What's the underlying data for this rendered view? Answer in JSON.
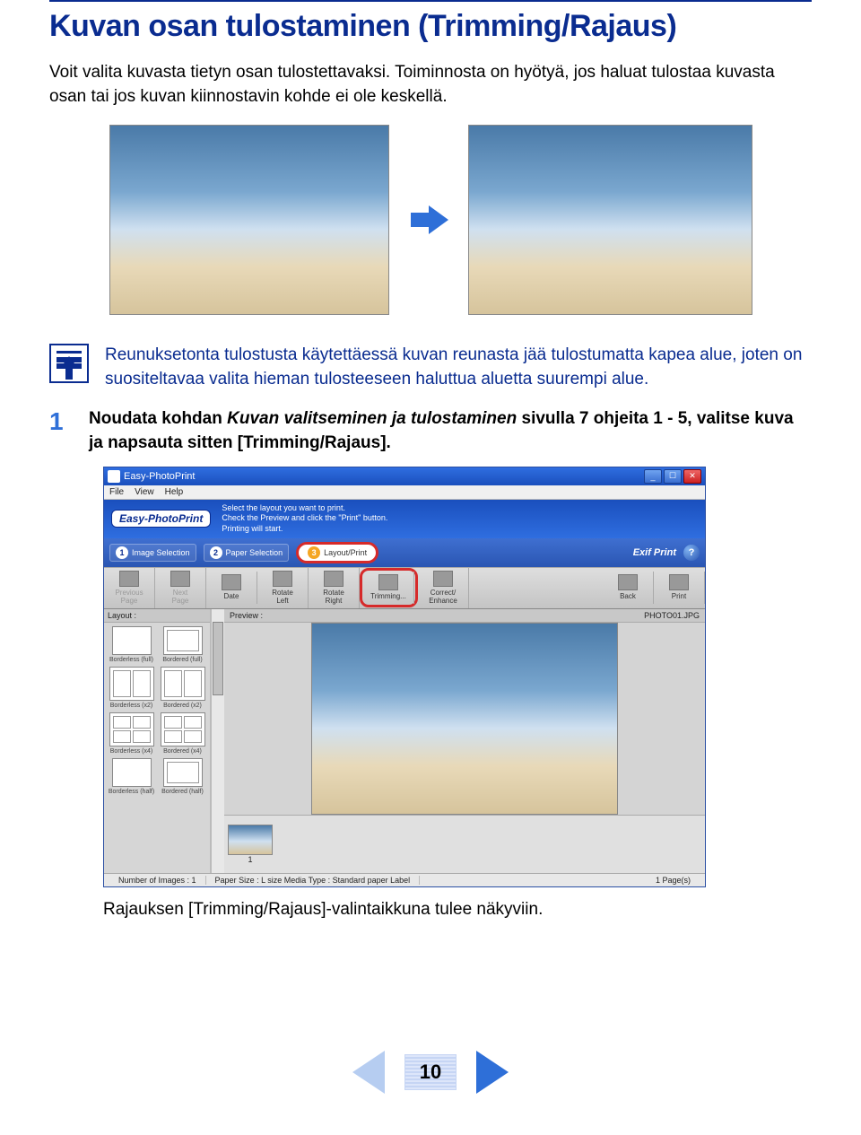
{
  "heading": "Kuvan osan tulostaminen (Trimming/Rajaus)",
  "intro": "Voit valita kuvasta tietyn osan tulostettavaksi. Toiminnosta on hyötyä, jos haluat tulostaa kuvasta osan tai jos kuvan kiinnostavin kohde ei ole keskellä.",
  "note": "Reunuksetonta tulostusta käytettäessä kuvan reunasta jää tulostumatta kapea alue, joten on suositeltavaa valita hieman tulosteeseen haluttua aluetta suurempi alue.",
  "step": {
    "num": "1",
    "prefix": "Noudata kohdan ",
    "em": "Kuvan valitseminen ja tulostaminen",
    "suffix": " sivulla 7 ohjeita 1 - 5, valitse kuva ja napsauta sitten [Trimming/Rajaus]."
  },
  "app": {
    "title": "Easy-PhotoPrint",
    "menu": [
      "File",
      "View",
      "Help"
    ],
    "brand": "Easy-PhotoPrint",
    "brand_lines": "Select the layout you want to print.\nCheck the Preview and click the \"Print\" button.\nPrinting will start.",
    "wizard": [
      {
        "num": "1",
        "label": "Image Selection"
      },
      {
        "num": "2",
        "label": "Paper Selection"
      },
      {
        "num": "3",
        "label": "Layout/Print"
      }
    ],
    "exif": "Exif Print",
    "help_q": "?",
    "toolbar": {
      "prev_page": "Previous\nPage",
      "next_page": "Next\nPage",
      "date": "Date",
      "rotate_left": "Rotate\nLeft",
      "rotate_right": "Rotate\nRight",
      "trimming": "Trimming...",
      "correct": "Correct/\nEnhance",
      "back": "Back",
      "print": "Print"
    },
    "layout_label": "Layout :",
    "layouts": [
      "Borderless (full)",
      "Bordered (full)",
      "Borderless (x2)",
      "Bordered (x2)",
      "Borderless (x4)",
      "Bordered (x4)",
      "Borderless (half)",
      "Bordered (half)"
    ],
    "preview_label": "Preview :",
    "preview_file": "PHOTO01.JPG",
    "thumb_num": "1",
    "status_left": "Number of Images : 1",
    "status_mid": "Paper Size : L size  Media Type : Standard paper Label",
    "status_right": "1 Page(s)"
  },
  "caption": "Rajauksen [Trimming/Rajaus]-valintaikkuna tulee näkyviin.",
  "page_number": "10"
}
